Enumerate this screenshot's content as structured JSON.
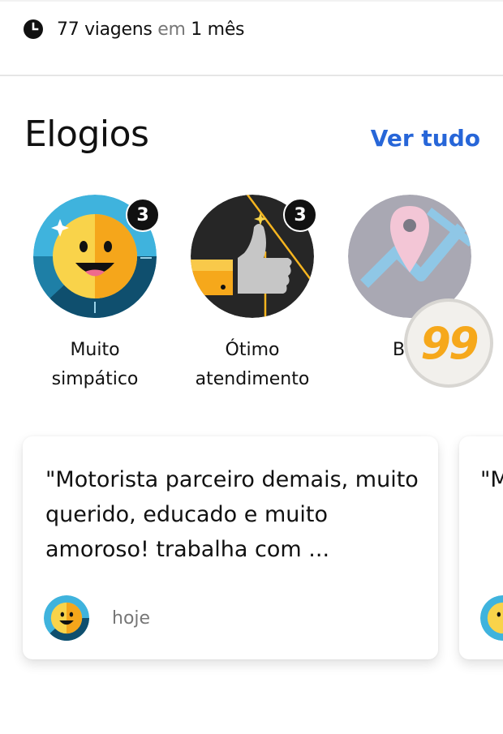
{
  "summary": {
    "trips_count_text": "77 viagens",
    "connector_text": "em",
    "period_text": "1 mês",
    "icon": "clock-icon"
  },
  "compliments": {
    "title": "Elogios",
    "see_all_label": "Ver tudo",
    "accent_color": "#2766d8",
    "badges": [
      {
        "label_line1": "Muito",
        "label_line2": "simpático",
        "count": "3",
        "icon": "smiley-badge-icon"
      },
      {
        "label_line1": "Ótimo",
        "label_line2": "atendimento",
        "count": "3",
        "icon": "thumbs-up-badge-icon"
      },
      {
        "label_line1": "Boa",
        "label_line2": "",
        "count": "",
        "icon": "map-pin-badge-icon"
      }
    ]
  },
  "overlay_logo": {
    "text": "99",
    "color": "#f6a81b"
  },
  "reviews": [
    {
      "text": "\"Motorista parceiro demais, muito querido, educado e muito amoroso! trabalha com ...",
      "time": "hoje",
      "avatar_icon": "smiley-avatar-icon"
    },
    {
      "text": "\"M",
      "time": "",
      "avatar_icon": "smiley-avatar-icon"
    }
  ]
}
